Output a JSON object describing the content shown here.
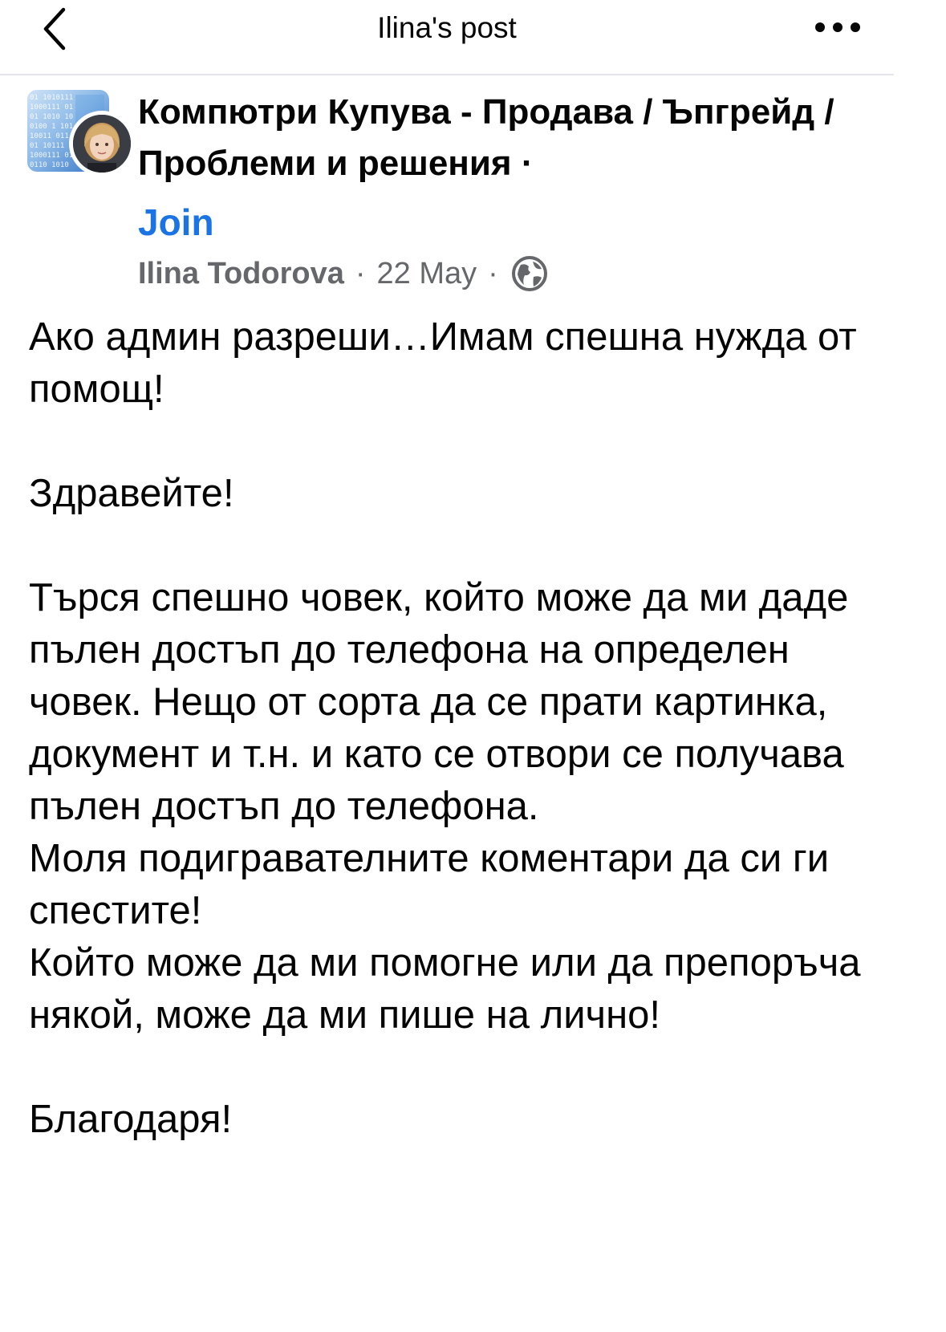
{
  "top_bar": {
    "title": "Ilina's post",
    "back_icon": "chevron-left-icon",
    "more_icon": "more-horizontal-icon"
  },
  "post": {
    "group_name": "Компютри Купува - Продава / Ъпгрейд / Проблеми и решения",
    "group_separator": "·",
    "join_label": "Join",
    "author": "Ilina Todorova",
    "date": "22 May",
    "meta_separator": "·",
    "privacy_icon": "globe-icon",
    "body": "Ако админ разреши…Имам спешна нужда от помощ!\n\nЗдравейте!\n\nТърся спешно човек, който може да ми даде пълен достъп до телефона на определен човек. Нещо от сорта да се прати картинка, документ и т.н. и като се отвори се получава пълен достъп до телефона.\nМоля подигравателните коментари да си ги спестите!\nКойто може да ми помогне или да препоръча някой, може да ми пише на лично!\n\nБлагодаря!"
  },
  "colors": {
    "link_blue": "#1b74e4",
    "meta_gray": "#65676b",
    "text": "#050505"
  }
}
